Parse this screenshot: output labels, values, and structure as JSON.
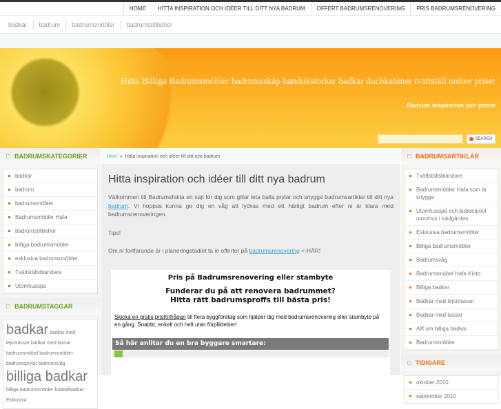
{
  "nav": [
    "HOME",
    "HITTA INSPIRATION OCH IDÉER TILL DITT NYA BADRUM",
    "OFFERT BADRUMSRENOVERING",
    "PRIS BADRUMSRENOVERING"
  ],
  "subnav": [
    "badkar",
    "badrum",
    "badrumsmöbler",
    "badrumstillbehör"
  ],
  "header": {
    "title": "Hitta Billiga Badrumsmöbler badrumsskåp handukstorkar badkar duchkabiner tvättställ online priser",
    "tagline": "Badrum inspiration och priser",
    "search_value": "",
    "search_label": "SEARCH"
  },
  "left": {
    "categories_title": "BADRUMSKATEGORIER",
    "categories": [
      "badkar",
      "badrum",
      "badrumsmöbler",
      "Badrumsmöbler Hafa",
      "badrumstillbehör",
      "billiga badrumsmöbler",
      "exklusiva badrumsmöbler",
      "Tvättställsblandare",
      "Utomhusspa"
    ],
    "tags_title": "BADRUMSTAGGAR",
    "tags": [
      {
        "t": "badkar",
        "big": true
      },
      {
        "t": "badkar med lejontassar"
      },
      {
        "t": "badkar med tassar"
      },
      {
        "t": "badrumsmöbel"
      },
      {
        "t": "badrumsmöbler"
      },
      {
        "t": "badrumsprylar"
      },
      {
        "t": "badrumsvåg"
      },
      {
        "t": "billiga badkar",
        "big": true
      },
      {
        "t": "billiga badrumsmöbler"
      },
      {
        "t": "bubbelbadkar"
      },
      {
        "t": "Exklusiva"
      }
    ]
  },
  "main": {
    "crumb_home": "Hem",
    "crumb_sep": "»",
    "crumb_current": "Hitta inspiration och idéer till ditt nya badrum",
    "title": "Hitta inspiration och idéer till ditt nya badrum",
    "p1a": "Välkommen till Badrumsfakta en sajt för dig som gillar leta balla prylar och snygga badrumsartiklar till ditt nya ",
    "p1link": "badrum",
    "p1b": ". Vi hoppas kunna ge dig en våg att lyckas med ett härligt badrum efter ni är klara med badrumsrenoveringen.",
    "tips": "Tips!",
    "p2a": "Om ni fortfarande är i planeringstadiet ta in offerter på ",
    "p2link": "badrumsrenovering",
    "p2b": " <-HÄR!",
    "ad": {
      "h2": "Pris på Badrumsrenovering eller stambyte",
      "h3a": "Funderar du på att renovera badrummet?",
      "h3b": "Hitta rätt badrumsproffs till bästa pris!",
      "link": "Skicka en gratis prisförfrågan",
      "text": " till flera byggföretag som hjälper dig med badrumsrenovering eller stambyte på en gång. Snabbt, enkelt och helt utan förpliktelser!",
      "bar": "Så här anlitar du en bra byggare smartare:"
    }
  },
  "right": {
    "articles_title": "BADRUMSARTIKLAR",
    "articles": [
      "Tvättställsblandare",
      "Badrumsmöbler Hafa som är snygga",
      "Utomhusspa och bubbelpool utomhus i trädgården",
      "Exklusiva badrumsmöbler",
      "Billiga badrumsmöbler",
      "Badrumsvåg",
      "Badrumsmöbel Hafa Kioto",
      "Billiga badkar",
      "Badkar med lejontassar",
      "Badkar med tassar",
      "Allt om billiga badkar",
      "Badrumsmöbler"
    ],
    "archive_title": "TIDIGARE",
    "archive": [
      "oktober 2010",
      "september 2010"
    ]
  }
}
